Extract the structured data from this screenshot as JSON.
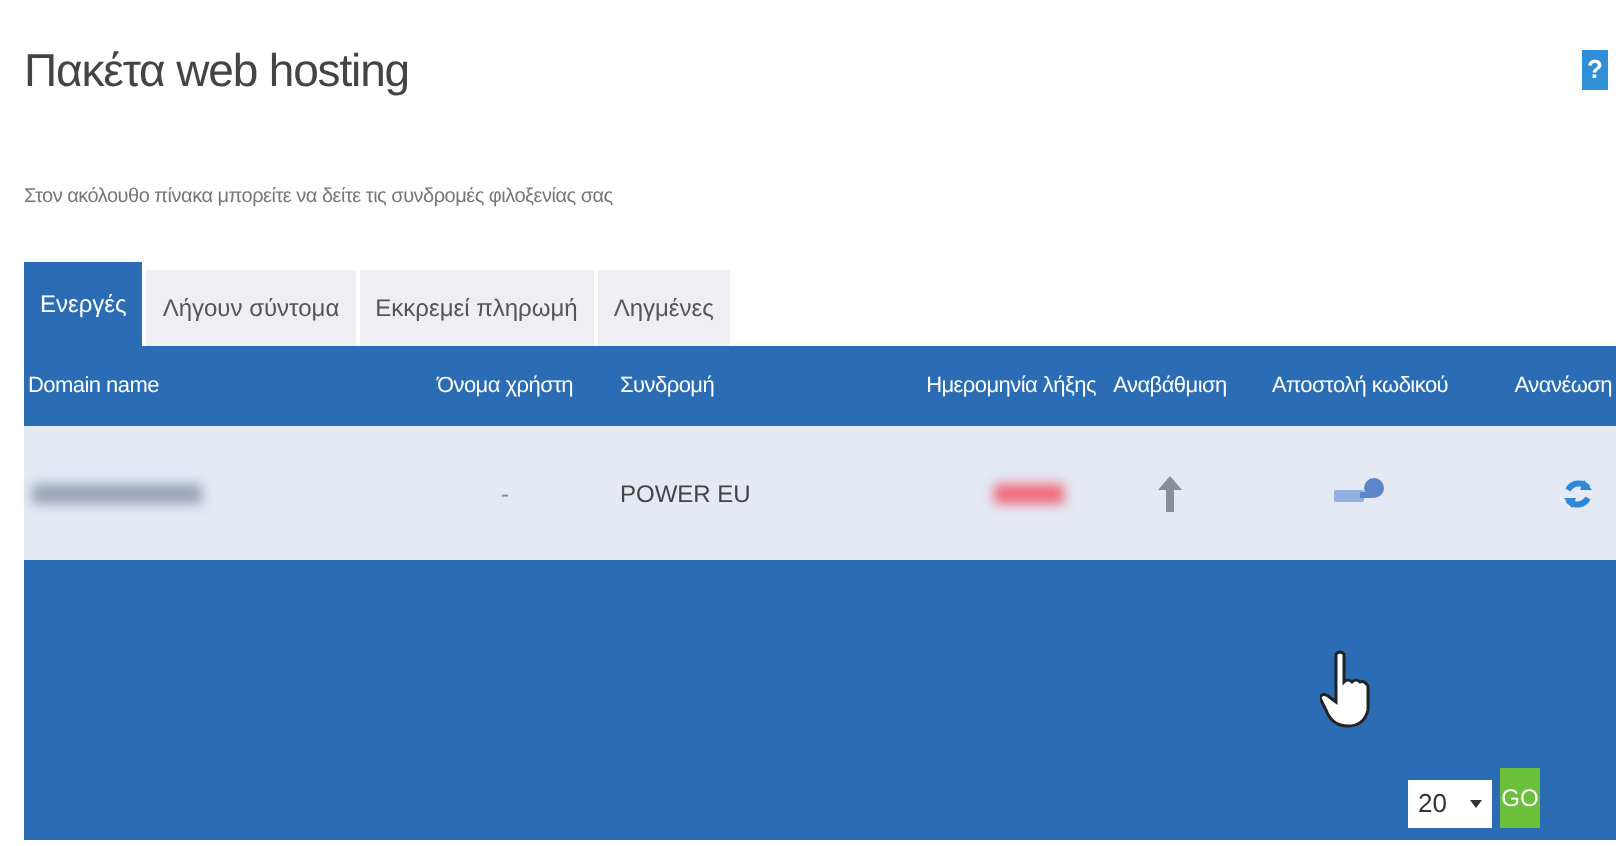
{
  "page": {
    "title": "Πακέτα web hosting",
    "help_button": "?",
    "subtitle": "Στον ακόλουθο πίνακα μπορείτε να δείτε τις συνδρομές φιλοξενίας σας"
  },
  "tabs": [
    {
      "label": "Ενεργές",
      "selected": true
    },
    {
      "label": "Λήγουν σύντομα",
      "selected": false
    },
    {
      "label": "Εκκρεμεί πληρωμή",
      "selected": false
    },
    {
      "label": "Ληγμένες",
      "selected": false
    }
  ],
  "table": {
    "columns": [
      "Domain name",
      "Όνομα χρήστη",
      "Συνδρομή",
      "Ημερομηνία λήξης",
      "Αναβάθμιση",
      "Αποστολή κωδικού",
      "Ανανέωση"
    ],
    "rows": [
      {
        "username": "-",
        "plan": "POWER EU"
      }
    ]
  },
  "pagination": {
    "page_size": "20",
    "go": "GO"
  }
}
